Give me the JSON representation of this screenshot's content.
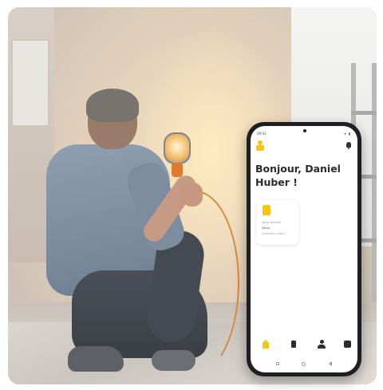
{
  "phone": {
    "status": {
      "time": "09:41",
      "icons": "▾ ▮"
    },
    "greeting": "Bonjour, Daniel Huber !",
    "card": {
      "label": "Votre Activité",
      "value": "Devis",
      "sub": "Consulter votre..."
    },
    "tabs": [
      "home-icon",
      "document-icon",
      "user-icon",
      "more-icon"
    ],
    "accent_color": "#f5c518"
  }
}
